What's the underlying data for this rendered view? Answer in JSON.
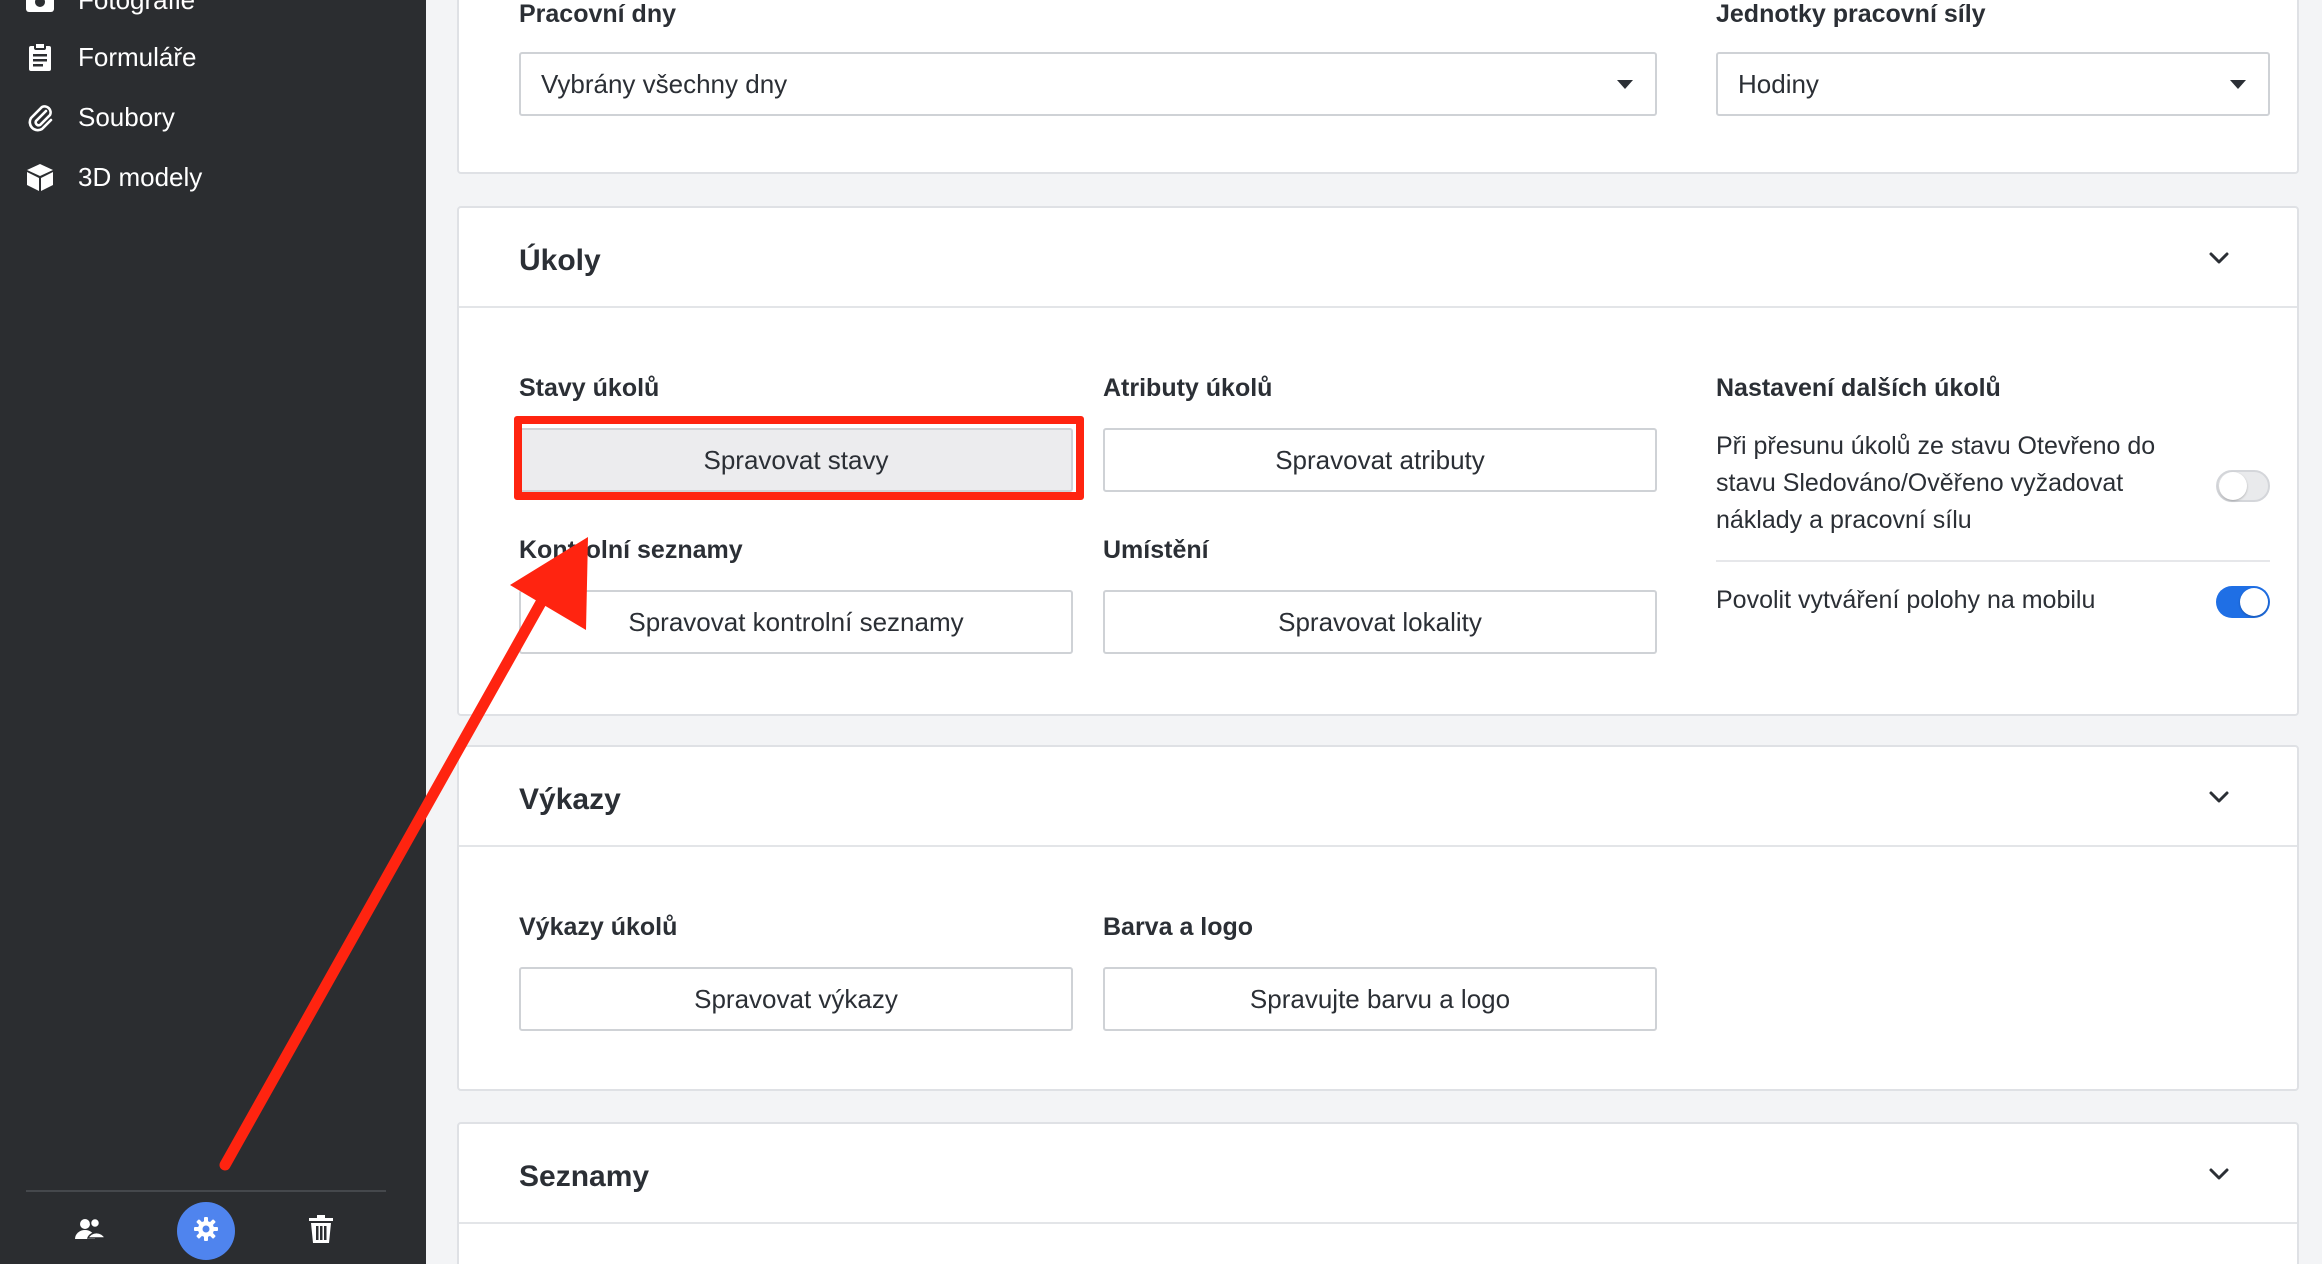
{
  "sidebar": {
    "items": [
      {
        "label": "Fotografie",
        "icon": "camera-icon"
      },
      {
        "label": "Formuláře",
        "icon": "clipboard-icon"
      },
      {
        "label": "Soubory",
        "icon": "paperclip-icon"
      },
      {
        "label": "3D modely",
        "icon": "cube-icon"
      }
    ],
    "footer": [
      {
        "icon": "users-icon"
      },
      {
        "icon": "gear-icon",
        "active": true
      },
      {
        "icon": "trash-icon"
      }
    ]
  },
  "general": {
    "workdays_label": "Pracovní dny",
    "workdays_value": "Vybrány všechny dny",
    "workforce_units_label": "Jednotky pracovní síly",
    "workforce_units_value": "Hodiny"
  },
  "tasks": {
    "title": "Úkoly",
    "states_label": "Stavy úkolů",
    "states_button": "Spravovat stavy",
    "attributes_label": "Atributy úkolů",
    "attributes_button": "Spravovat atributy",
    "checklists_label": "Kontrolní seznamy",
    "checklists_button": "Spravovat kontrolní seznamy",
    "locations_label": "Umístění",
    "locations_button": "Spravovat lokality",
    "more_settings_label": "Nastavení dalších úkolů",
    "setting_1_text": "Při přesunu úkolů ze stavu Otevřeno do stavu Sledováno/Ověřeno vyžadovat náklady a pracovní sílu",
    "setting_1_enabled": false,
    "setting_2_text": "Povolit vytváření polohy na mobilu",
    "setting_2_enabled": true
  },
  "reports": {
    "title": "Výkazy",
    "task_reports_label": "Výkazy úkolů",
    "task_reports_button": "Spravovat výkazy",
    "color_logo_label": "Barva a logo",
    "color_logo_button": "Spravujte barvu a logo"
  },
  "lists": {
    "title": "Seznamy"
  },
  "colors": {
    "sidebar_bg": "#2b2d30",
    "accent": "#1f6fe5",
    "annotation": "#ff2410"
  }
}
